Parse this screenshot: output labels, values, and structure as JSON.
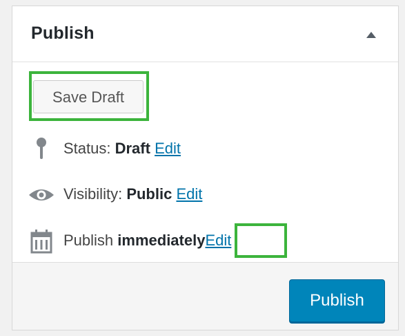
{
  "panel": {
    "title": "Publish",
    "toggle_icon": "triangle-up-icon"
  },
  "actions": {
    "save_draft_label": "Save Draft"
  },
  "misc": [
    {
      "id": "status",
      "icon": "pin-icon",
      "label": "Status:",
      "value": "Draft",
      "edit_label": "Edit"
    },
    {
      "id": "visibility",
      "icon": "eye-icon",
      "label": "Visibility:",
      "value": "Public",
      "edit_label": "Edit"
    },
    {
      "id": "schedule",
      "icon": "calendar-icon",
      "label": "Publish",
      "value": "immediately",
      "edit_label": "Edit"
    }
  ],
  "footer": {
    "publish_label": "Publish"
  },
  "colors": {
    "highlight": "#3cb43c",
    "primary_button": "#0085ba",
    "link": "#0073aa"
  }
}
